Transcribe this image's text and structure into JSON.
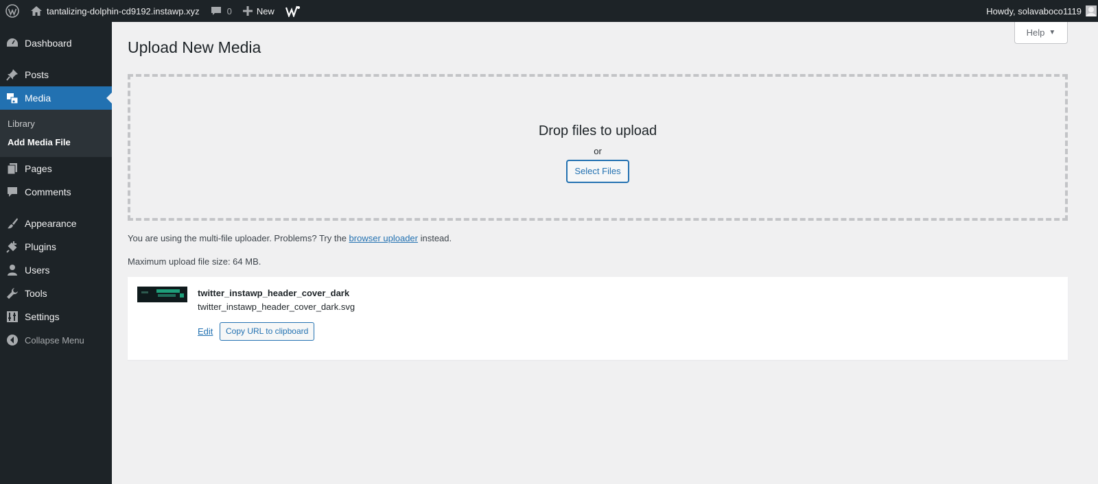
{
  "adminbar": {
    "site_name": "tantalizing-dolphin-cd9192.instawp.xyz",
    "comments_count": "0",
    "new_label": "New",
    "howdy": "Howdy, solavaboco1119"
  },
  "sidebar": {
    "items": [
      {
        "label": "Dashboard",
        "icon": "dashboard-icon"
      },
      {
        "label": "Posts",
        "icon": "pin-icon"
      },
      {
        "label": "Media",
        "icon": "media-icon"
      },
      {
        "label": "Pages",
        "icon": "pages-icon"
      },
      {
        "label": "Comments",
        "icon": "comment-icon"
      },
      {
        "label": "Appearance",
        "icon": "brush-icon"
      },
      {
        "label": "Plugins",
        "icon": "plugin-icon"
      },
      {
        "label": "Users",
        "icon": "users-icon"
      },
      {
        "label": "Tools",
        "icon": "wrench-icon"
      },
      {
        "label": "Settings",
        "icon": "settings-icon"
      }
    ],
    "media_submenu": [
      "Library",
      "Add Media File"
    ],
    "collapse_label": "Collapse Menu"
  },
  "help": {
    "label": "Help"
  },
  "main": {
    "title": "Upload New Media",
    "drop_title": "Drop files to upload",
    "or_text": "or",
    "select_files": "Select Files",
    "uploader_prefix": "You are using the multi-file uploader. Problems? Try the ",
    "uploader_link": "browser uploader",
    "uploader_suffix": " instead.",
    "max_size": "Maximum upload file size: 64 MB."
  },
  "media_item": {
    "title": "twitter_instawp_header_cover_dark",
    "filename": "twitter_instawp_header_cover_dark.svg",
    "edit_label": "Edit",
    "copy_label": "Copy URL to clipboard"
  },
  "colors": {
    "adminbar_bg": "#1d2327",
    "accent": "#2271b1",
    "page_bg": "#f0f0f1"
  }
}
